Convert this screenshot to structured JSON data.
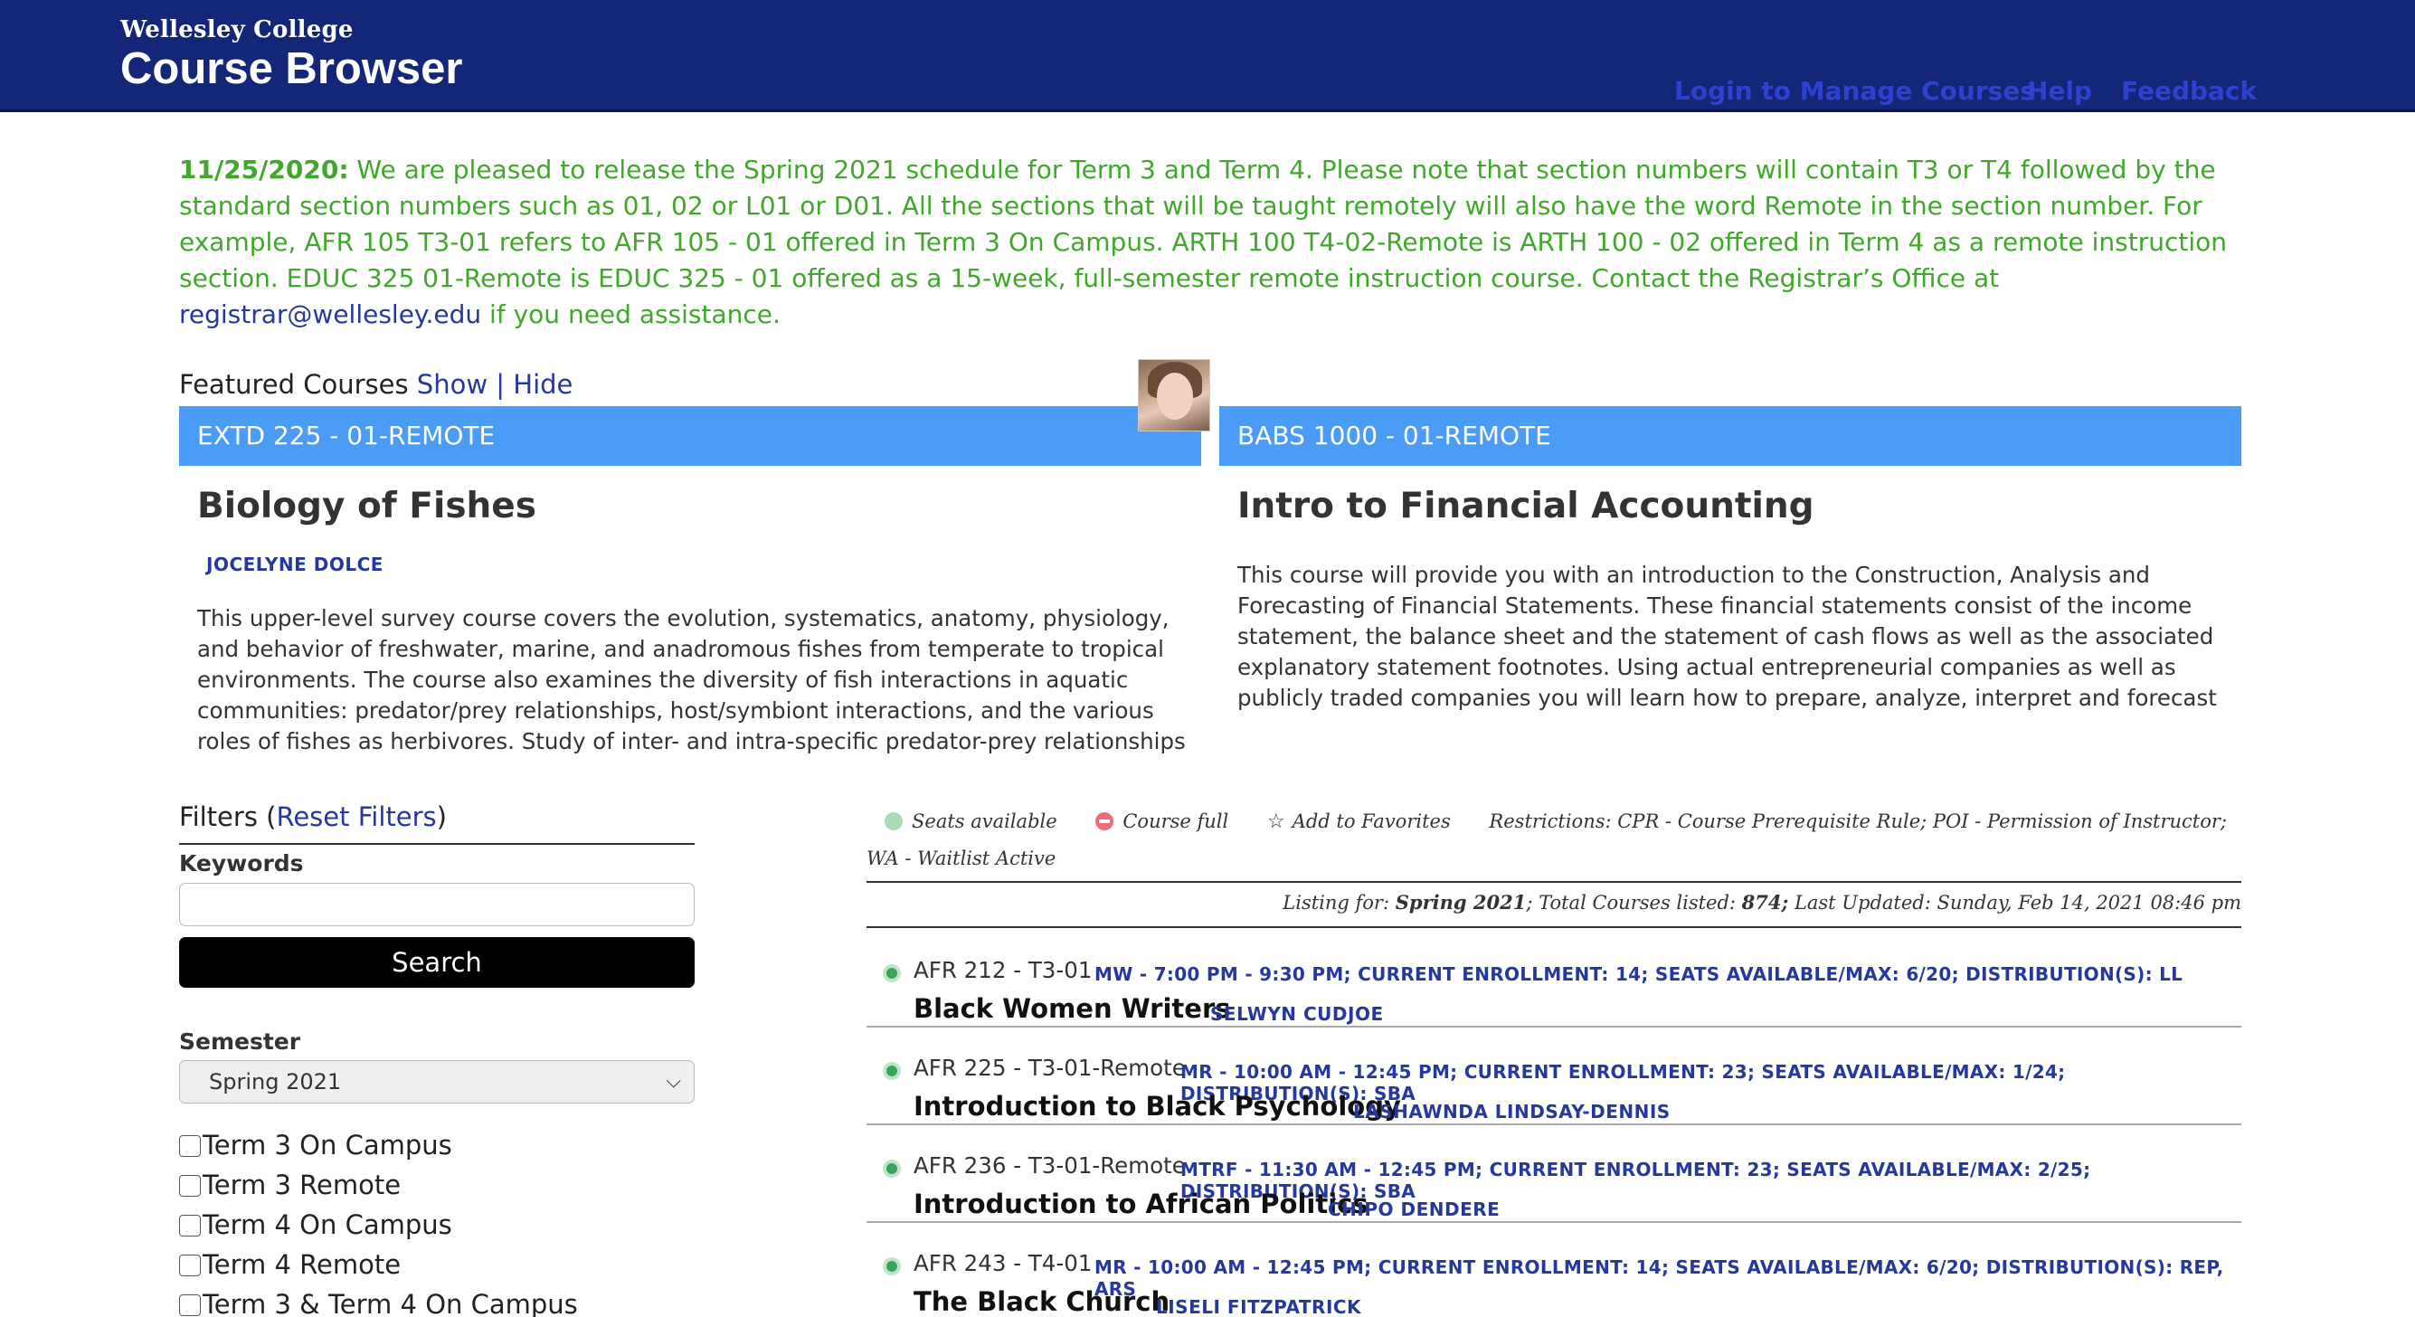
{
  "header": {
    "college": "Wellesley College",
    "app_title": "Course Browser",
    "nav": {
      "login": "Login to Manage Courses",
      "help": "Help",
      "feedback": "Feedback"
    }
  },
  "announcement": {
    "date": "11/25/2020:",
    "text": " We are pleased to release the Spring 2021 schedule for Term 3 and Term 4. Please note that section numbers will contain T3 or T4 followed by the standard section numbers such as 01, 02 or L01 or D01. All the sections that will be taught remotely will also have the word Remote in the section number. For example, AFR 105 T3-01 refers to AFR 105 - 01 offered in Term 3 On Campus. ARTH 100 T4-02-Remote is ARTH 100 - 02 offered in Term 4 as a remote instruction section. EDUC 325 01-Remote is EDUC 325 - 01 offered as a 15-week, full-semester remote instruction course. Contact the Registrar’s Office at ",
    "email": "registrar@wellesley.edu",
    "tail": " if you need assistance."
  },
  "featured": {
    "label": "Featured Courses ",
    "show": "Show",
    "sep": " | ",
    "hide": "Hide",
    "cards": [
      {
        "bar": "EXTD 225 - 01-REMOTE",
        "title": "Biology of Fishes",
        "instructor": "JOCELYNE DOLCE",
        "description": "This upper-level survey course covers the evolution, systematics, anatomy, physiology, and behavior of freshwater, marine, and anadromous fishes from temperate to tropical environments. The course also examines the diversity of fish interactions in aquatic communities: predator/prey relationships, host/symbiont interactions, and the various roles of fishes as herbivores. Study of inter- and intra-specific predator-prey relationships among fish populations"
      },
      {
        "bar": "BABS 1000 - 01-REMOTE",
        "title": "Intro to Financial Accounting",
        "description": "This course will provide you with an introduction to the Construction, Analysis and Forecasting of Financial Statements. These financial statements consist of the income statement, the balance sheet and the statement of cash flows as well as the associated explanatory statement footnotes. Using actual entrepreneurial companies as well as publicly traded companies you will learn how to prepare, analyze, interpret and forecast financial statements. By the conclusion of the course,"
      }
    ]
  },
  "filters": {
    "title_pre": "Filters (",
    "reset": "Reset Filters",
    "title_post": ")",
    "keywords_label": "Keywords",
    "keywords_value": "",
    "search_label": "Search",
    "semester_label": "Semester",
    "semester_selected": "Spring 2021",
    "terms": [
      "Term 3 On Campus",
      "Term 3 Remote",
      "Term 4 On Campus",
      "Term 4 Remote",
      "Term 3 & Term 4 On Campus"
    ]
  },
  "legend": {
    "seats": "Seats available",
    "full": "Course full",
    "favorites": "Add to Favorites",
    "restrictions": "Restrictions: CPR - Course Prerequisite Rule; POI - Permission of Instructor; WA - Waitlist Active"
  },
  "listing": {
    "prefix": "Listing for: ",
    "semester": "Spring 2021",
    "total_prefix": "; Total Courses listed: ",
    "total": "874;",
    "updated": " Last Updated: Sunday, Feb 14, 2021 08:46 pm"
  },
  "courses": [
    {
      "code": "AFR 212 - T3-01",
      "meta": "MW - 7:00 PM - 9:30 PM; CURRENT ENROLLMENT: 14; SEATS AVAILABLE/MAX: 6/20; DISTRIBUTION(S): LL",
      "title": "Black Women Writers",
      "instructor": "SELWYN CUDJOE"
    },
    {
      "code": "AFR 225 - T3-01-Remote",
      "meta": "MR - 10:00 AM - 12:45 PM; CURRENT ENROLLMENT: 23; SEATS AVAILABLE/MAX: 1/24; DISTRIBUTION(S): SBA",
      "title": "Introduction to Black Psychology",
      "instructor": "LASHAWNDA LINDSAY-DENNIS"
    },
    {
      "code": "AFR 236 - T3-01-Remote",
      "meta": "MTRF - 11:30 AM - 12:45 PM; CURRENT ENROLLMENT: 23; SEATS AVAILABLE/MAX: 2/25; DISTRIBUTION(S): SBA",
      "title": "Introduction to African Politics",
      "instructor": "CHIPO DENDERE"
    },
    {
      "code": "AFR 243 - T4-01",
      "meta": "MR - 10:00 AM - 12:45 PM; CURRENT ENROLLMENT: 14; SEATS AVAILABLE/MAX: 6/20; DISTRIBUTION(S): REP, ARS",
      "title": "The Black Church",
      "instructor": "LISELI FITZPATRICK"
    }
  ]
}
